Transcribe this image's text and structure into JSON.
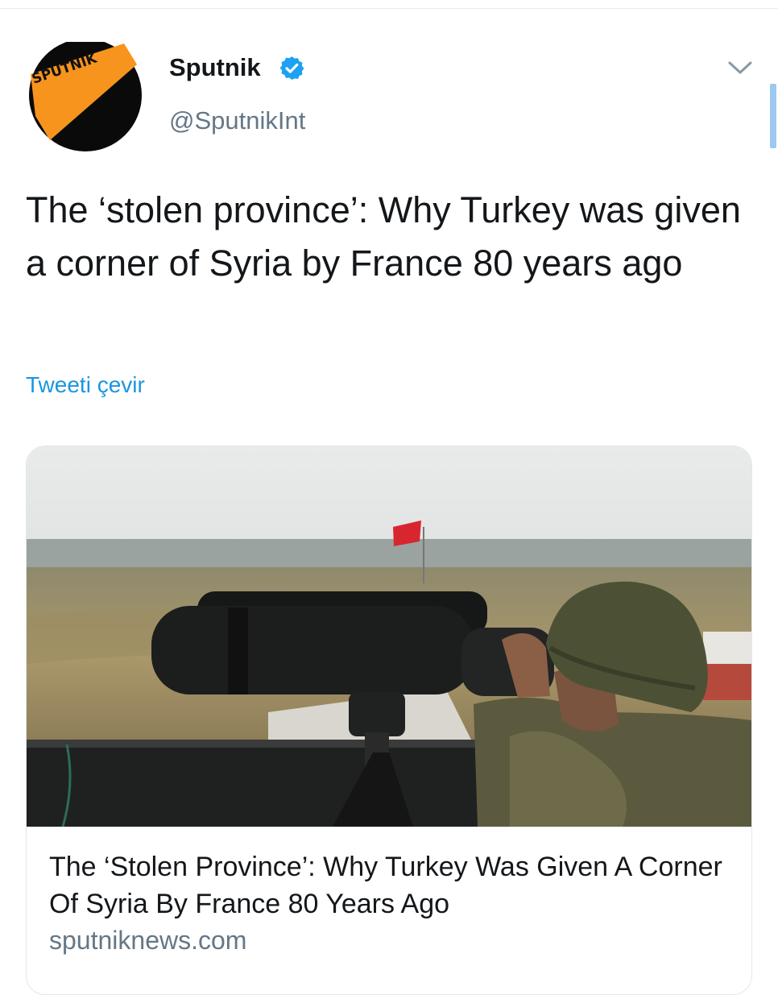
{
  "tweet": {
    "author_name": "Sputnik",
    "author_handle": "@SputnikInt",
    "logo_text": "SPUTNIK",
    "text": "The ‘stolen province’: Why Turkey was given a corner of Syria by France 80 years ago",
    "translate_label": "Tweeti çevir"
  },
  "card": {
    "title": "The ‘Stolen Province’: Why Turkey Was Given A Corner Of Syria By France 80 Years Ago",
    "domain": "sputniknews.com"
  },
  "icons": {
    "verified": "verified-badge-icon",
    "menu": "chevron-down-icon"
  },
  "colors": {
    "verified_blue": "#1da1f2",
    "link_blue": "#1b95e0",
    "secondary_text": "#657786",
    "brand_orange": "#f7941d"
  }
}
